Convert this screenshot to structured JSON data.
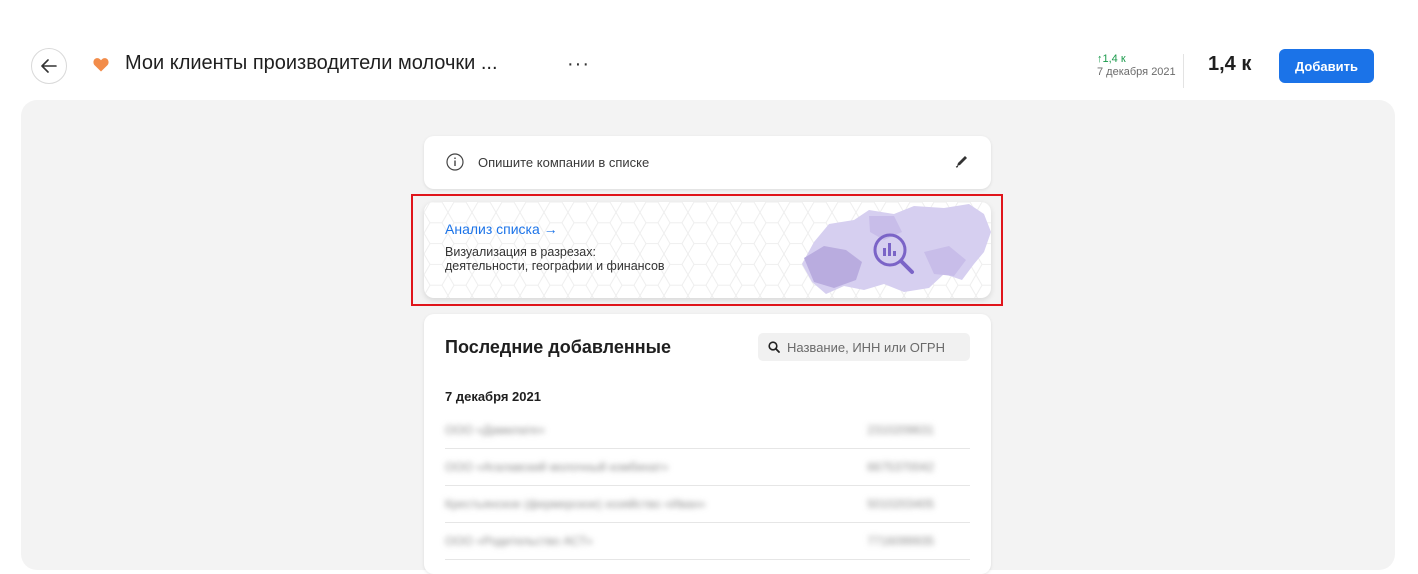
{
  "header": {
    "title": "Мои клиенты производители молочки ...",
    "more": "···",
    "delta": "↑1,4 к",
    "delta_date": "7 декабря 2021",
    "count": "1,4 к",
    "add_label": "Добавить",
    "accent_color": "#1b73e8",
    "heart_color": "#f28c4a"
  },
  "description": {
    "placeholder": "Опишите компании в списке"
  },
  "analysis": {
    "title": "Анализ списка →",
    "subtitle_line1": "Визуализация в разрезах:",
    "subtitle_line2": "деятельности, географии и финансов"
  },
  "recent": {
    "title": "Последние добавленные",
    "search_placeholder": "Название, ИНН или ОГРН",
    "date": "7 декабря 2021",
    "rows": [
      {
        "name": "ООО «Дамилате»",
        "inn": "2310209631"
      },
      {
        "name": "ООО «Агалавский молочный комбинат»",
        "inn": "6675370042"
      },
      {
        "name": "Крестьянское (фермерское) хозяйство «Иван»",
        "inn": "5010203405"
      },
      {
        "name": "ООО «Родительство АСТ»",
        "inn": "7716099935"
      }
    ]
  }
}
